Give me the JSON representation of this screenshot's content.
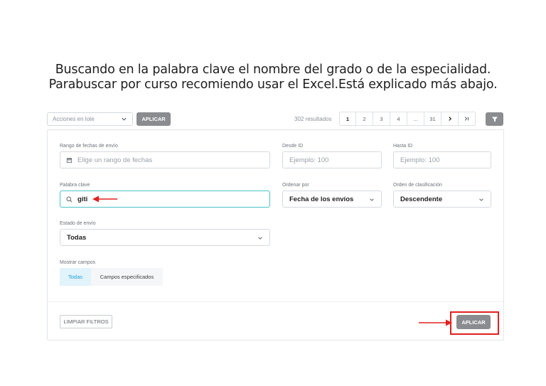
{
  "caption": {
    "line1": "Buscando en la palabra clave el nombre del grado o de la especialidad.",
    "line2": "Parabuscar por curso recomiendo usar el Excel.Está explicado más abajo."
  },
  "toolbar": {
    "bulk_actions": "Acciones en lote",
    "apply": "APLICAR",
    "results": "302 resultados",
    "pages": [
      "1",
      "2",
      "3",
      "4",
      "...",
      "31"
    ],
    "next_icon": "chevron-right-icon",
    "last_icon": "chevron-double-right-icon",
    "filter_icon": "funnel-icon"
  },
  "filters": {
    "date_range": {
      "label": "Rango de fechas de envío",
      "placeholder": "Elige un rango de fechas"
    },
    "from_id": {
      "label": "Desde ID",
      "placeholder": "Ejemplo: 100"
    },
    "to_id": {
      "label": "Hasta ID",
      "placeholder": "Ejemplo: 100"
    },
    "keyword": {
      "label": "Palabra clave",
      "value": "giti"
    },
    "order_by": {
      "label": "Ordenar por",
      "value": "Fecha de los envíos"
    },
    "sort_order": {
      "label": "Orden de clasificación",
      "value": "Descendente"
    },
    "status": {
      "label": "Estado de envío",
      "value": "Todas"
    },
    "show_fields": {
      "label": "Mostrar campos",
      "options": [
        "Todas",
        "Campos especificados"
      ],
      "selected": "Todas"
    }
  },
  "footer": {
    "clear": "LIMPIAR FILTROS",
    "apply": "APLICAR"
  },
  "colors": {
    "accent": "#4cc3c7",
    "annotation": "#e02020",
    "button": "#8a8c8f"
  }
}
